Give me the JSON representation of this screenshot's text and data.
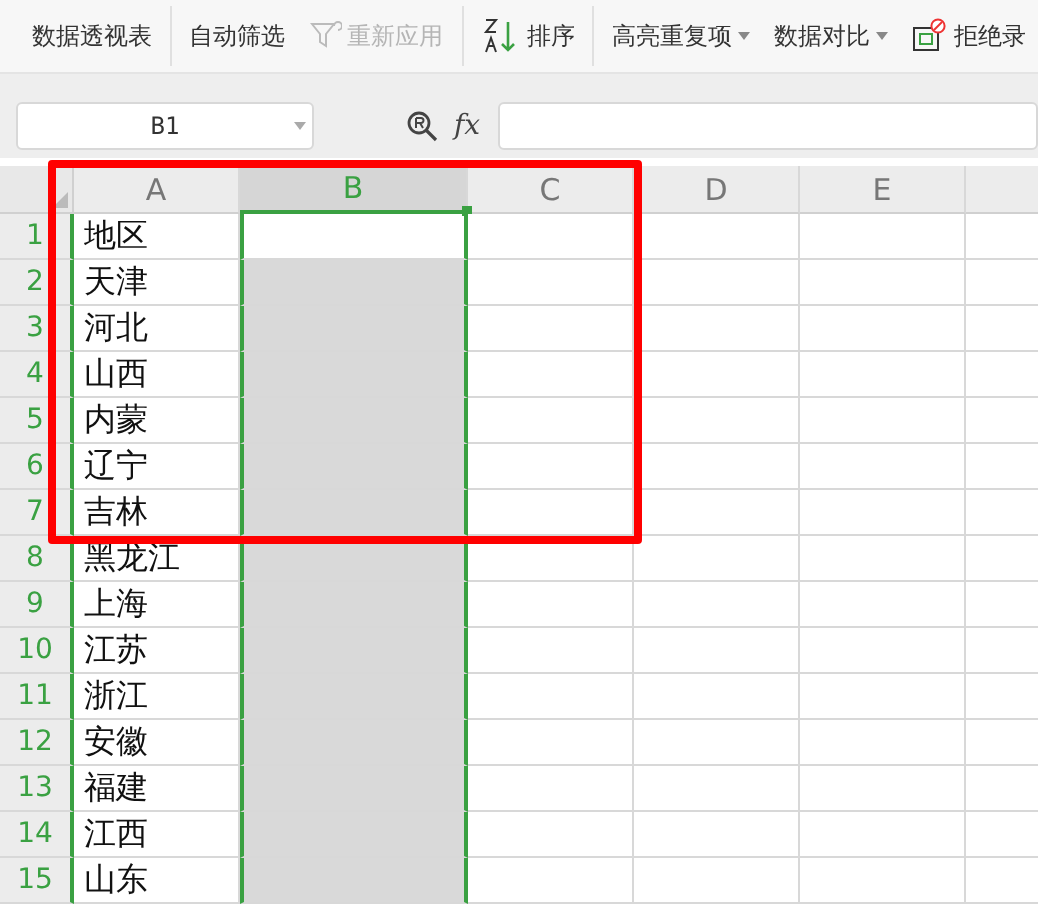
{
  "toolbar": [
    {
      "label": "数据透视表",
      "kind": "text",
      "disabled": false,
      "dropdown": false
    },
    {
      "label": "自动筛选",
      "kind": "text",
      "disabled": false,
      "dropdown": false
    },
    {
      "label": "重新应用",
      "kind": "filter",
      "disabled": true,
      "dropdown": false
    },
    {
      "label": "排序",
      "kind": "sort",
      "disabled": false,
      "dropdown": false
    },
    {
      "label": "高亮重复项",
      "kind": "text",
      "disabled": false,
      "dropdown": true
    },
    {
      "label": "数据对比",
      "kind": "text",
      "disabled": false,
      "dropdown": true
    },
    {
      "label": "拒绝录",
      "kind": "reject",
      "disabled": false,
      "dropdown": false
    }
  ],
  "formula_bar": {
    "name_box": "B1",
    "fx": "fx"
  },
  "columns": [
    {
      "label": "A",
      "selected": false
    },
    {
      "label": "B",
      "selected": true
    },
    {
      "label": "C",
      "selected": false
    },
    {
      "label": "D",
      "selected": false
    },
    {
      "label": "E",
      "selected": false
    }
  ],
  "rows": [
    {
      "number": "1",
      "cells": [
        "地区"
      ]
    },
    {
      "number": "2",
      "cells": [
        "天津"
      ]
    },
    {
      "number": "3",
      "cells": [
        "河北"
      ]
    },
    {
      "number": "4",
      "cells": [
        "山西"
      ]
    },
    {
      "number": "5",
      "cells": [
        "内蒙"
      ]
    },
    {
      "number": "6",
      "cells": [
        "辽宁"
      ]
    },
    {
      "number": "7",
      "cells": [
        "吉林"
      ]
    },
    {
      "number": "8",
      "cells": [
        "黑龙江"
      ]
    },
    {
      "number": "9",
      "cells": [
        "上海"
      ]
    },
    {
      "number": "10",
      "cells": [
        "江苏"
      ]
    },
    {
      "number": "11",
      "cells": [
        "浙江"
      ]
    },
    {
      "number": "12",
      "cells": [
        "安徽"
      ]
    },
    {
      "number": "13",
      "cells": [
        "福建"
      ]
    },
    {
      "number": "14",
      "cells": [
        "江西"
      ]
    },
    {
      "number": "15",
      "cells": [
        "山东"
      ]
    }
  ],
  "annotation": {
    "kind": "frame",
    "color": "#ff0000"
  }
}
